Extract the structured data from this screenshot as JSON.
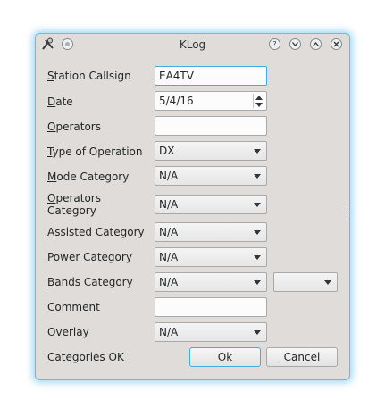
{
  "window": {
    "title": "KLog",
    "accent": "#3daee9"
  },
  "labels": {
    "station_callsign": [
      "",
      "S",
      "tation Callsign"
    ],
    "date": [
      "",
      "D",
      "ate"
    ],
    "operators": [
      "",
      "O",
      "perators"
    ],
    "type_of_operation": [
      "",
      "T",
      "ype of Operation"
    ],
    "mode_category": [
      "",
      "M",
      "ode Category"
    ],
    "operators_category_line1": [
      "",
      "O",
      "perators"
    ],
    "operators_category_line2": "Category",
    "assisted_category": [
      "",
      "A",
      "ssisted Category"
    ],
    "power_category": [
      "Po",
      "w",
      "er Category"
    ],
    "bands_category": [
      "",
      "B",
      "ands Category"
    ],
    "comment": [
      "Comm",
      "e",
      "nt"
    ],
    "overlay": [
      "O",
      "v",
      "erlay"
    ]
  },
  "fields": {
    "station_callsign": "EA4TV",
    "date": "5/4/16",
    "operators": "",
    "type_of_operation": "DX",
    "mode_category": "N/A",
    "operators_category": "N/A",
    "assisted_category": "N/A",
    "power_category": "N/A",
    "bands_category": "N/A",
    "bands_secondary": "",
    "comment": "",
    "overlay": "N/A"
  },
  "status": "Categories OK",
  "buttons": {
    "ok": [
      "",
      "O",
      "k"
    ],
    "cancel": [
      "",
      "C",
      "ancel"
    ]
  },
  "icons": {
    "app": "klog-app-icon",
    "sticky": "sticky-icon",
    "help": "help-icon",
    "minimize": "minimize-icon",
    "maximize": "maximize-icon",
    "close": "close-icon"
  }
}
